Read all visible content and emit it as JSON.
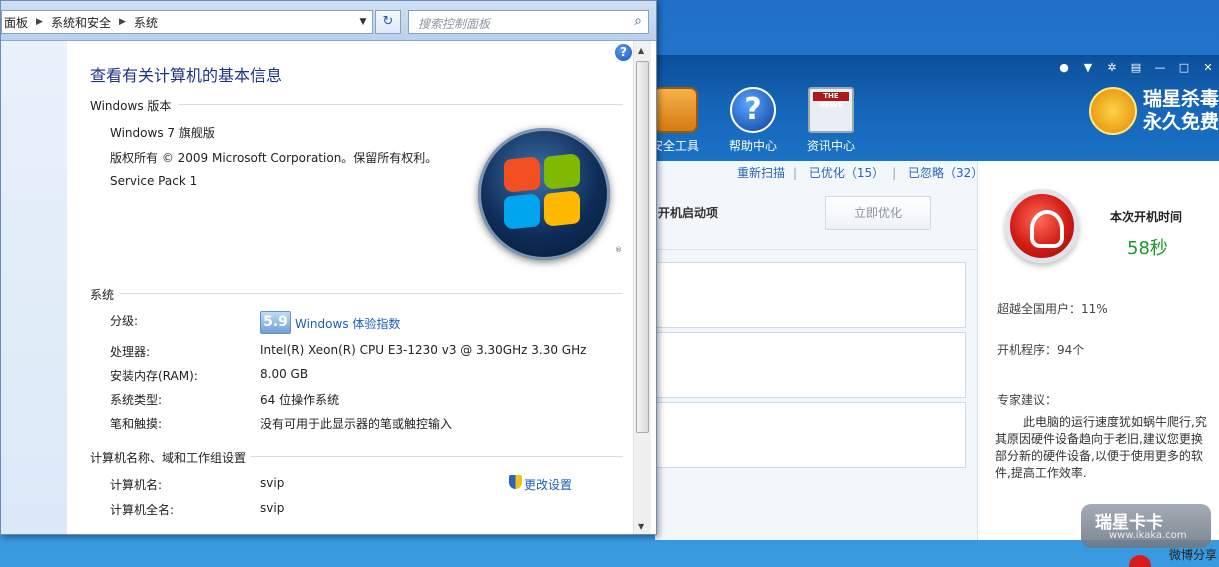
{
  "explorer": {
    "breadcrumb": [
      "面板",
      "系统和安全",
      "系统"
    ],
    "search_placeholder": "搜索控制面板",
    "help_label": "?",
    "page_title": "查看有关计算机的基本信息",
    "windows_edition": {
      "header": "Windows 版本",
      "name": "Windows 7 旗舰版",
      "copyright": "版权所有 © 2009 Microsoft Corporation。保留所有权利。",
      "service_pack": "Service Pack 1"
    },
    "system": {
      "header": "系统",
      "rating_label": "分级:",
      "rating_score": "5.9",
      "rating_link": "Windows 体验指数",
      "processor_label": "处理器:",
      "processor_value": "Intel(R) Xeon(R) CPU E3-1230 v3 @ 3.30GHz   3.30 GHz",
      "ram_label": "安装内存(RAM):",
      "ram_value": "8.00 GB",
      "type_label": "系统类型:",
      "type_value": "64 位操作系统",
      "pen_label": "笔和触摸:",
      "pen_value": "没有可用于此显示器的笔或触控输入"
    },
    "computer": {
      "header": "计算机名称、域和工作组设置",
      "name_label": "计算机名:",
      "name_value": "svip",
      "fullname_label": "计算机全名:",
      "fullname_value": "svip",
      "change_settings": "更改设置"
    }
  },
  "rising": {
    "toolbar": [
      {
        "label": "安全工具",
        "icon": "toolbox-icon"
      },
      {
        "label": "帮助中心",
        "icon": "help-icon"
      },
      {
        "label": "资讯中心",
        "icon": "news-icon"
      }
    ],
    "news_icon_text": "THE NEWS",
    "brand_line1": "瑞星杀毒",
    "brand_line2": "永久免费",
    "links": {
      "rescan": "重新扫描",
      "optimized": "已优化（15）",
      "ignored": "已忽略（32）"
    },
    "startup_items": "开机启动项",
    "optimize_now": "立即优化",
    "boot_time_title": "本次开机时间",
    "boot_time_value": "58秒",
    "beat_users": "超越全国用户：11%",
    "startup_programs": "开机程序：94个",
    "advice_title": "专家建议：",
    "advice_text": "此电脑的运行速度犹如蜗牛爬行,究其原因硬件设备趋向于老旧,建议您更换部分新的硬件设备,以便于使用更多的软件,提高工作效率.",
    "watermark_title": "瑞星卡卡",
    "watermark_url": "www.ikaka.com",
    "share": "微博分享"
  }
}
